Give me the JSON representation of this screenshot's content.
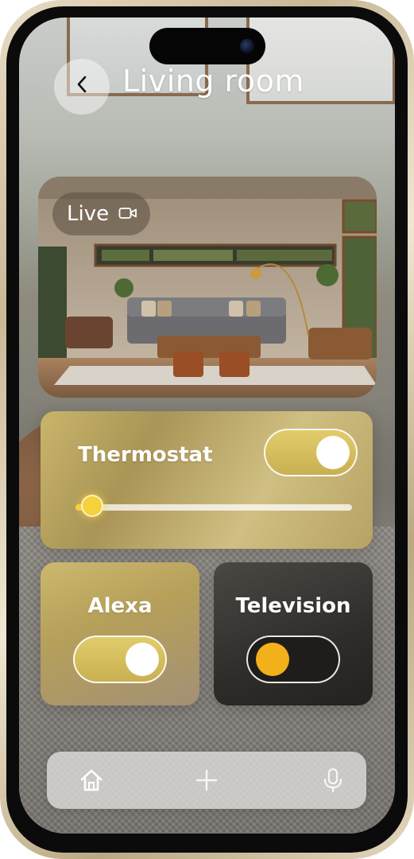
{
  "header": {
    "title": "Living room",
    "back_icon": "chevron-left-icon"
  },
  "camera": {
    "live_label": "Live",
    "live_icon": "video-camera-icon"
  },
  "thermostat": {
    "label": "Thermostat",
    "toggle_on": true,
    "slider_level": 0.06
  },
  "alexa": {
    "label": "Alexa",
    "toggle_on": true
  },
  "television": {
    "label": "Television",
    "toggle_on": false
  },
  "bottom_nav": {
    "items": [
      {
        "icon": "home-icon",
        "active": true
      },
      {
        "icon": "plus-icon",
        "active": false
      },
      {
        "icon": "microphone-icon",
        "active": false
      }
    ]
  },
  "colors": {
    "accent_gold": "#d9c263",
    "knob_orange": "#f2b01a",
    "slider_yellow": "#f3cf3a"
  }
}
